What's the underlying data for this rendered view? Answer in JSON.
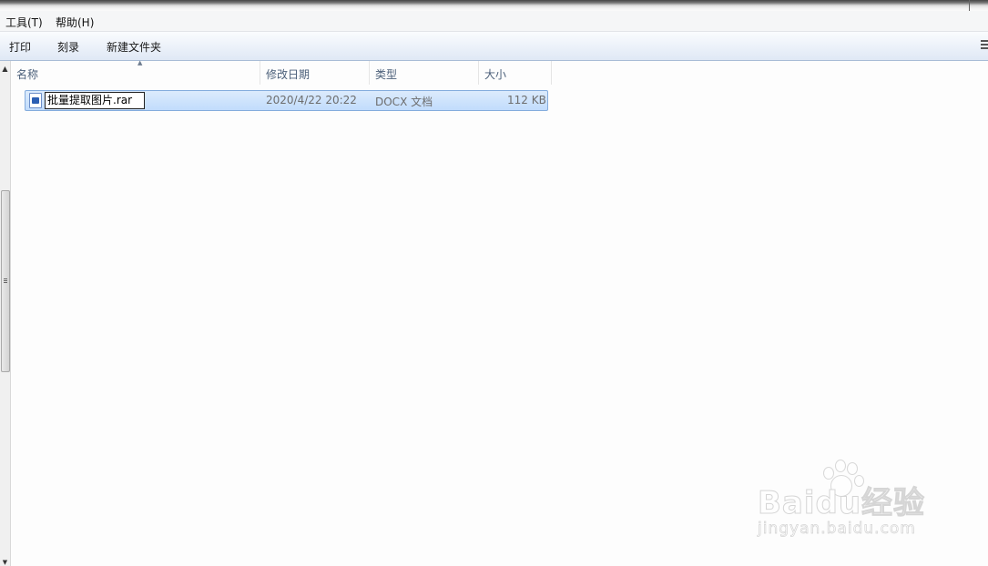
{
  "menubar": {
    "items": [
      "工具(T)",
      "帮助(H)"
    ]
  },
  "toolbar": {
    "buttons": [
      "打印",
      "刻录",
      "新建文件夹"
    ],
    "view_icon": "view-options-icon"
  },
  "columns": [
    "名称",
    "修改日期",
    "类型",
    "大小"
  ],
  "files": [
    {
      "name": "批量提取图片.rar",
      "modified": "2020/4/22 20:22",
      "type": "DOCX 文档",
      "size": "112 KB",
      "icon": "word-document-icon",
      "selected": true,
      "renaming": true
    }
  ],
  "watermark": {
    "logo": "Baidu经验",
    "url": "jingyan.baidu.com"
  },
  "colors": {
    "selection": "#cce4fc",
    "selection_border": "#84acdd",
    "header_text": "#4c607a"
  }
}
